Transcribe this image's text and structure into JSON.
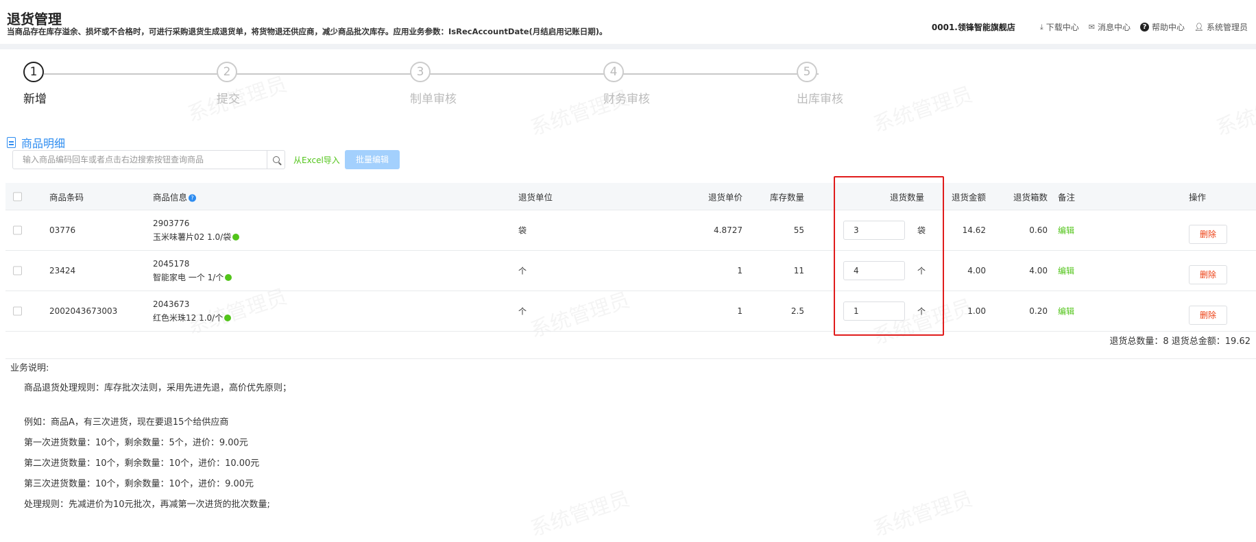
{
  "header": {
    "title": "退货管理",
    "description": "当商品存在库存溢余、损坏或不合格时，可进行采购退货生成退货单，将货物退还供应商，减少商品批次库存。应用业务参数：IsRecAccountDate(月结启用记账日期)。",
    "store": "0001.领锋智能旗舰店",
    "download_center": "下载中心",
    "message_center": "消息中心",
    "help_center": "帮助中心",
    "user": "系统管理员"
  },
  "watermark_text": "系统管理员",
  "steps": [
    {
      "num": "1",
      "label": "新增",
      "active": true
    },
    {
      "num": "2",
      "label": "提交",
      "active": false
    },
    {
      "num": "3",
      "label": "制单审核",
      "active": false
    },
    {
      "num": "4",
      "label": "财务审核",
      "active": false
    },
    {
      "num": "5",
      "label": "出库审核",
      "active": false
    }
  ],
  "section": {
    "title": "商品明细"
  },
  "search": {
    "placeholder": "输入商品编码回车或者点击右边搜索按钮查询商品"
  },
  "toolbar": {
    "excel_import": "从Excel导入",
    "batch_edit": "批量编辑"
  },
  "table": {
    "headers": {
      "barcode": "商品条码",
      "info": "商品信息",
      "unit": "退货单位",
      "price": "退货单价",
      "stock": "库存数量",
      "qty": "退货数量",
      "amount": "退货金额",
      "boxes": "退货箱数",
      "remark": "备注",
      "action": "操作"
    },
    "rows": [
      {
        "barcode": "03776",
        "code": "2903776",
        "name": "玉米味薯片02 1.0/袋",
        "unit": "袋",
        "price": "4.8727",
        "stock": "55",
        "qty": "3",
        "qty_unit": "袋",
        "amount": "14.62",
        "boxes": "0.60",
        "edit": "编辑",
        "delete": "删除"
      },
      {
        "barcode": "23424",
        "code": "2045178",
        "name": "智能家电 一个 1/个",
        "unit": "个",
        "price": "1",
        "stock": "11",
        "qty": "4",
        "qty_unit": "个",
        "amount": "4.00",
        "boxes": "4.00",
        "edit": "编辑",
        "delete": "删除"
      },
      {
        "barcode": "2002043673003",
        "code": "2043673",
        "name": "红色米珠12 1.0/个",
        "unit": "个",
        "price": "1",
        "stock": "2.5",
        "qty": "1",
        "qty_unit": "个",
        "amount": "1.00",
        "boxes": "0.20",
        "edit": "编辑",
        "delete": "删除"
      }
    ]
  },
  "totals": "退货总数量：8 退货总金额：19.62",
  "notes": {
    "heading": "业务说明:",
    "lines": [
      "商品退货处理规则：库存批次法则，采用先进先退，高价优先原则；",
      "例如：商品A，有三次进货，现在要退15个给供应商",
      "第一次进货数量：10个，剩余数量：5个，进价：9.00元",
      "第二次进货数量：10个，剩余数量：10个，进价：10.00元",
      "第三次进货数量：10个，剩余数量：10个，进价：9.00元",
      "处理规则：先减进价为10元批次，再减第一次进货的批次数量;"
    ]
  },
  "colors": {
    "primary": "#2d8cf0",
    "success": "#52c41a",
    "danger": "#ed4014",
    "highlight": "#e01b1b"
  }
}
